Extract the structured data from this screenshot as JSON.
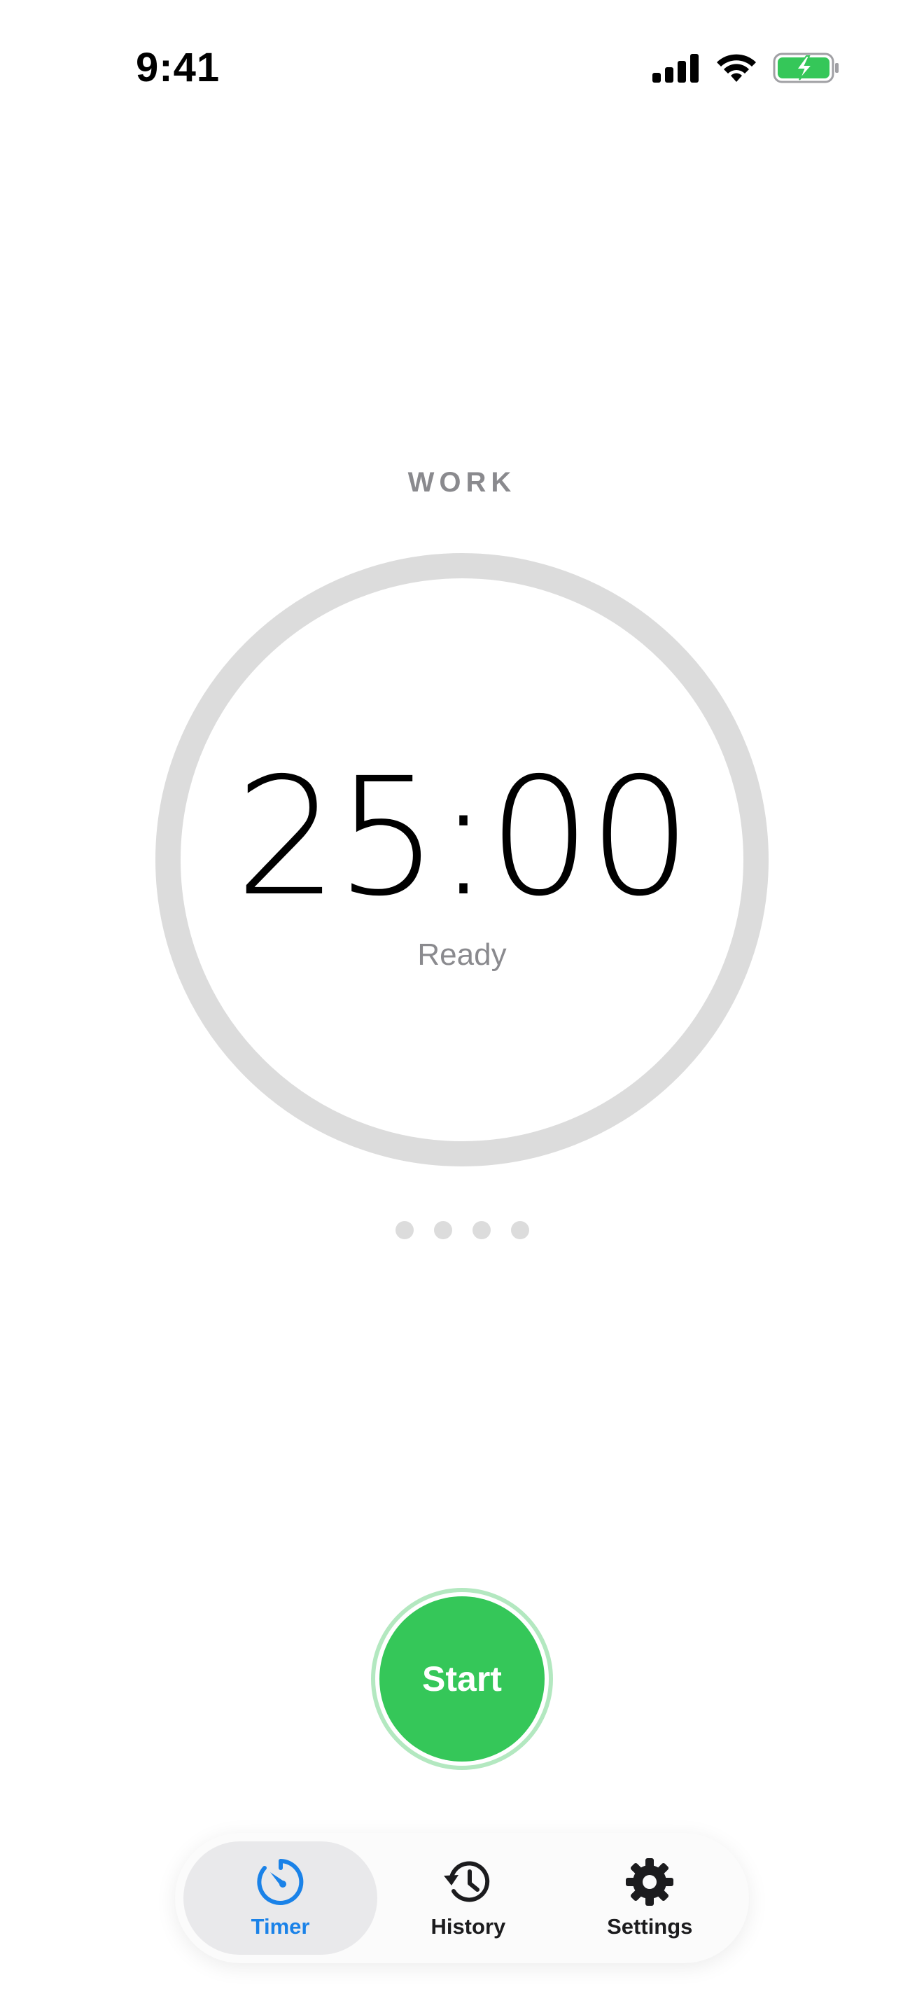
{
  "status_bar": {
    "time": "9:41"
  },
  "timer": {
    "mode": "WORK",
    "time": "25:00",
    "status": "Ready",
    "progress": 0,
    "sessions_total": 4,
    "sessions_completed": 0
  },
  "actions": {
    "start_label": "Start"
  },
  "tabs": [
    {
      "label": "Timer",
      "icon": "timer-icon",
      "active": true
    },
    {
      "label": "History",
      "icon": "history-icon",
      "active": false
    },
    {
      "label": "Settings",
      "icon": "gear-icon",
      "active": false
    }
  ],
  "colors": {
    "accent_blue": "#1a82e8",
    "start_green": "#35c759",
    "ring_track": "#dcdcdc",
    "secondary_text": "#8a8a8e",
    "battery_green": "#35c759"
  }
}
